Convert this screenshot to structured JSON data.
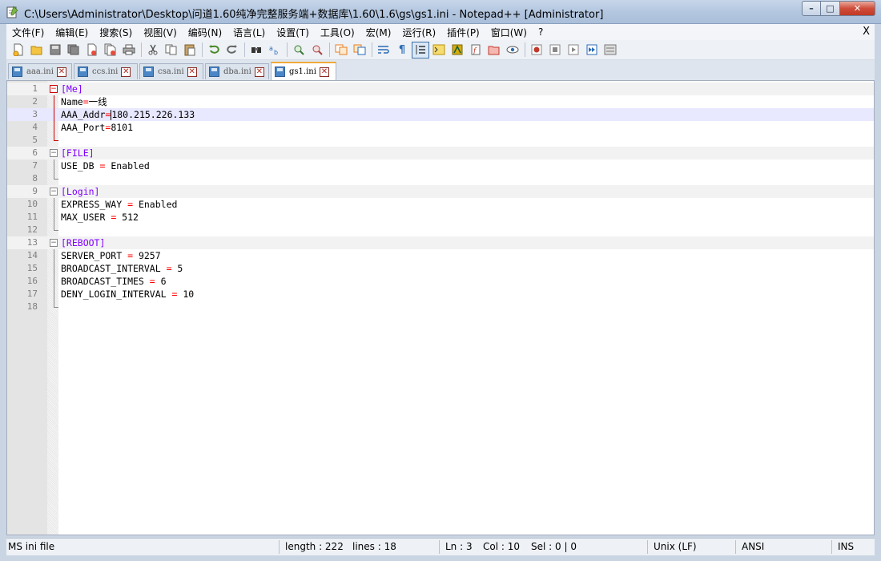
{
  "window": {
    "title": "C:\\Users\\Administrator\\Desktop\\问道1.60纯净完整服务端+数据库\\1.60\\1.6\\gs\\gs1.ini - Notepad++ [Administrator]",
    "minimize": "–",
    "maximize": "□",
    "close": "✕"
  },
  "menu": {
    "items": [
      "文件(F)",
      "编辑(E)",
      "搜索(S)",
      "视图(V)",
      "编码(N)",
      "语言(L)",
      "设置(T)",
      "工具(O)",
      "宏(M)",
      "运行(R)",
      "插件(P)",
      "窗口(W)",
      "?"
    ],
    "close": "X"
  },
  "toolbar": {
    "icons": [
      "new-file-icon",
      "open-file-icon",
      "save-icon",
      "save-all-icon",
      "close-icon",
      "close-all-icon",
      "print-icon",
      "cut-icon",
      "copy-icon",
      "paste-icon",
      "undo-icon",
      "redo-icon",
      "find-icon",
      "replace-icon",
      "zoom-in-icon",
      "zoom-out-icon",
      "sync-vertical-icon",
      "sync-horizontal-icon",
      "word-wrap-icon",
      "show-all-chars-icon",
      "indent-guide-icon",
      "udl-icon",
      "doc-map-icon",
      "function-list-icon",
      "folder-workspace-icon",
      "monitor-icon",
      "record-macro-icon",
      "stop-macro-icon",
      "play-macro-icon",
      "run-macro-multiple-icon",
      "save-macro-icon"
    ]
  },
  "tabs": [
    {
      "label": "aaa.ini",
      "close": "✕"
    },
    {
      "label": "ccs.ini",
      "close": "✕"
    },
    {
      "label": "csa.ini",
      "close": "✕"
    },
    {
      "label": "dba.ini",
      "close": "✕"
    },
    {
      "label": "gs1.ini",
      "close": "✕",
      "active": true
    }
  ],
  "editor": {
    "lines": [
      {
        "n": "1",
        "sec": "[Me]"
      },
      {
        "n": "2",
        "key": "Name",
        "op": "=",
        "val": "一线"
      },
      {
        "n": "3",
        "key": "AAA_Addr",
        "op": "=",
        "val": "180.215.226.133"
      },
      {
        "n": "4",
        "key": "AAA_Port",
        "op": "=",
        "val": "8101"
      },
      {
        "n": "5"
      },
      {
        "n": "6",
        "sec": "[FILE]"
      },
      {
        "n": "7",
        "key": "USE_DB ",
        "op": "=",
        "val": " Enabled"
      },
      {
        "n": "8"
      },
      {
        "n": "9",
        "sec": "[Login]"
      },
      {
        "n": "10",
        "key": "EXPRESS_WAY ",
        "op": "=",
        "val": " Enabled"
      },
      {
        "n": "11",
        "key": "MAX_USER ",
        "op": "=",
        "val": " 512"
      },
      {
        "n": "12"
      },
      {
        "n": "13",
        "sec": "[REBOOT]"
      },
      {
        "n": "14",
        "key": "SERVER_PORT ",
        "op": "=",
        "val": " 9257"
      },
      {
        "n": "15",
        "key": "BROADCAST_INTERVAL ",
        "op": "=",
        "val": " 5"
      },
      {
        "n": "16",
        "key": "BROADCAST_TIMES ",
        "op": "=",
        "val": " 6"
      },
      {
        "n": "17",
        "key": "DENY_LOGIN_INTERVAL ",
        "op": "=",
        "val": " 10"
      },
      {
        "n": "18"
      }
    ]
  },
  "status": {
    "file_type": "MS ini file",
    "length": "length : 222",
    "lines": "lines : 18",
    "ln": "Ln : 3",
    "col": "Col : 10",
    "sel": "Sel : 0 | 0",
    "eol": "Unix (LF)",
    "encoding": "ANSI",
    "mode": "INS"
  },
  "colors": {
    "section": "#8000ff",
    "operator": "#ff0000",
    "active_tab_accent": "#f1a93a"
  }
}
